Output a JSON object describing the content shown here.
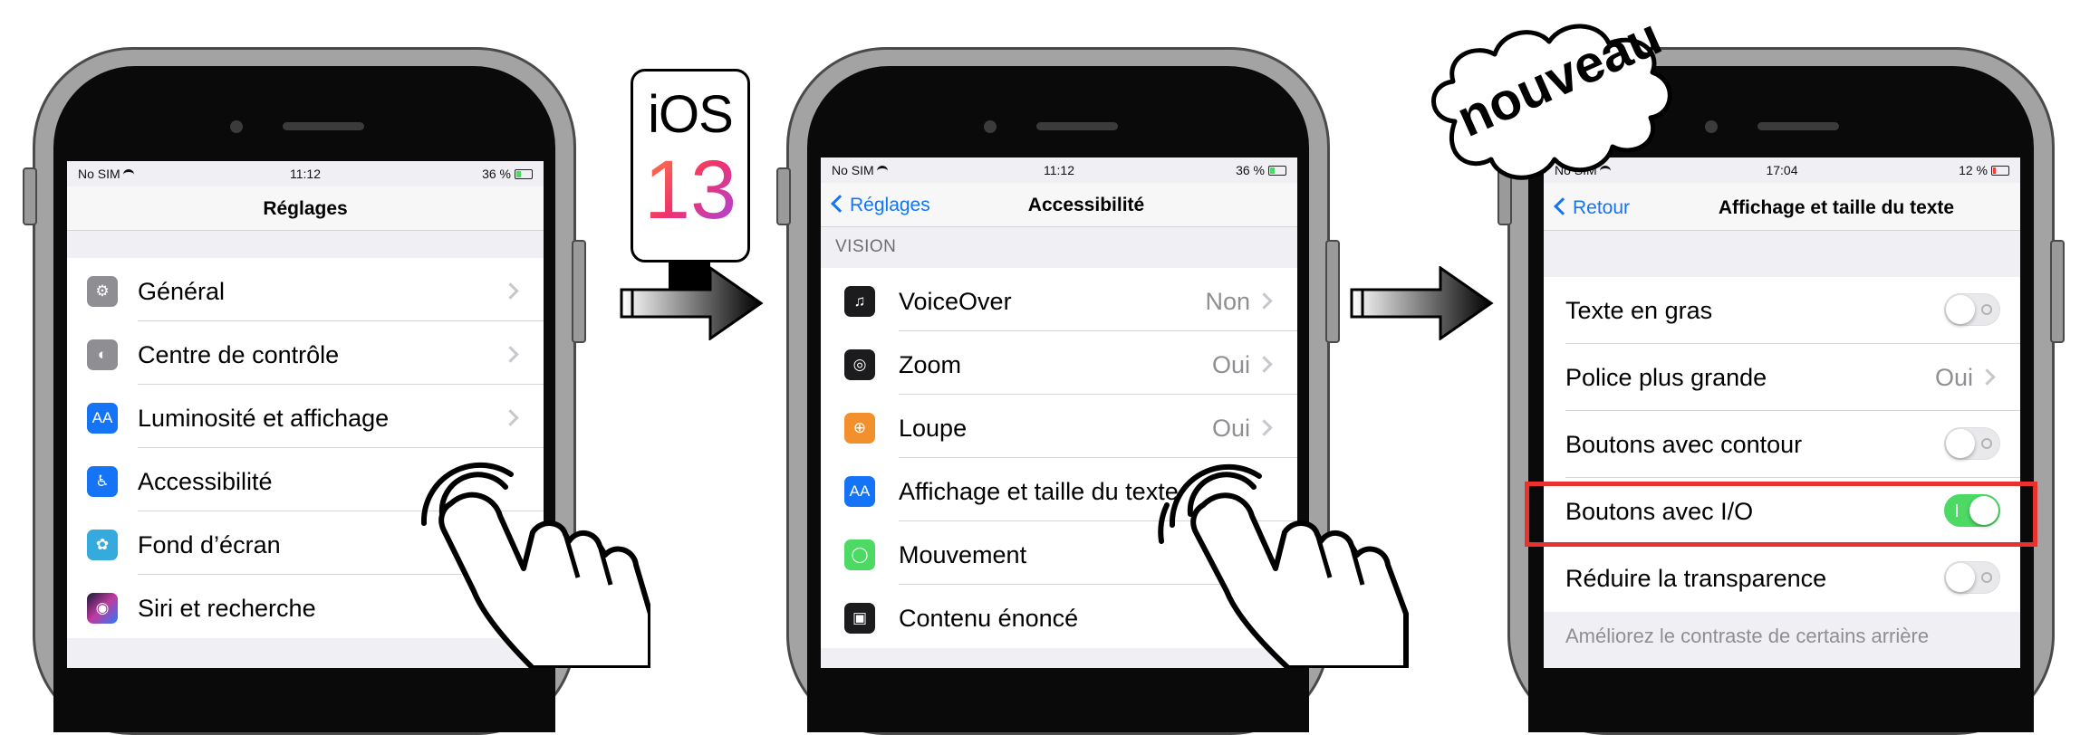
{
  "phone1": {
    "status": {
      "carrier": "No SIM",
      "time": "11:12",
      "battery": "36 %"
    },
    "nav": {
      "title": "Réglages"
    },
    "rows": [
      {
        "label": "Général",
        "icon": "gear-icon"
      },
      {
        "label": "Centre de contrôle",
        "icon": "switches-icon"
      },
      {
        "label": "Luminosité et affichage",
        "icon": "text-size-icon",
        "icon_text": "AA"
      },
      {
        "label": "Accessibilité",
        "icon": "accessibility-icon"
      },
      {
        "label": "Fond d’écran",
        "icon": "wallpaper-icon"
      },
      {
        "label": "Siri et recherche",
        "icon": "siri-icon"
      }
    ]
  },
  "badge": {
    "os": "iOS",
    "version": "13"
  },
  "phone2": {
    "status": {
      "carrier": "No SIM",
      "time": "11:12",
      "battery": "36 %"
    },
    "nav": {
      "back": "Réglages",
      "title": "Accessibilité"
    },
    "section": "VISION",
    "rows": [
      {
        "label": "VoiceOver",
        "value": "Non",
        "icon": "voiceover-icon"
      },
      {
        "label": "Zoom",
        "value": "Oui",
        "icon": "zoom-icon"
      },
      {
        "label": "Loupe",
        "value": "Oui",
        "icon": "magnifier-icon"
      },
      {
        "label": "Affichage et taille du texte",
        "value": "",
        "icon": "text-size-icon",
        "icon_text": "AA"
      },
      {
        "label": "Mouvement",
        "value": "",
        "icon": "motion-icon"
      },
      {
        "label": "Contenu énoncé",
        "value": "",
        "icon": "spoken-content-icon"
      }
    ]
  },
  "phone3": {
    "status": {
      "carrier": "No SIM",
      "time": "17:04",
      "battery": "12 %"
    },
    "nav": {
      "back": "Retour",
      "title": "Affichage et taille du texte"
    },
    "rows": [
      {
        "label": "Texte en gras",
        "control": "toggle",
        "on": false
      },
      {
        "label": "Police plus grande",
        "control": "value",
        "value": "Oui"
      },
      {
        "label": "Boutons avec contour",
        "control": "toggle",
        "on": false
      },
      {
        "label": "Boutons avec I/O",
        "control": "toggle",
        "on": true
      },
      {
        "label": "Réduire la transparence",
        "control": "toggle",
        "on": false
      }
    ],
    "footer": "Améliorez le contraste de certains arrière"
  },
  "cloud": {
    "text": "nouveau"
  },
  "colors": {
    "accent": "#1474f5",
    "toggle_on": "#4cd964",
    "highlight": "#e8322d"
  }
}
